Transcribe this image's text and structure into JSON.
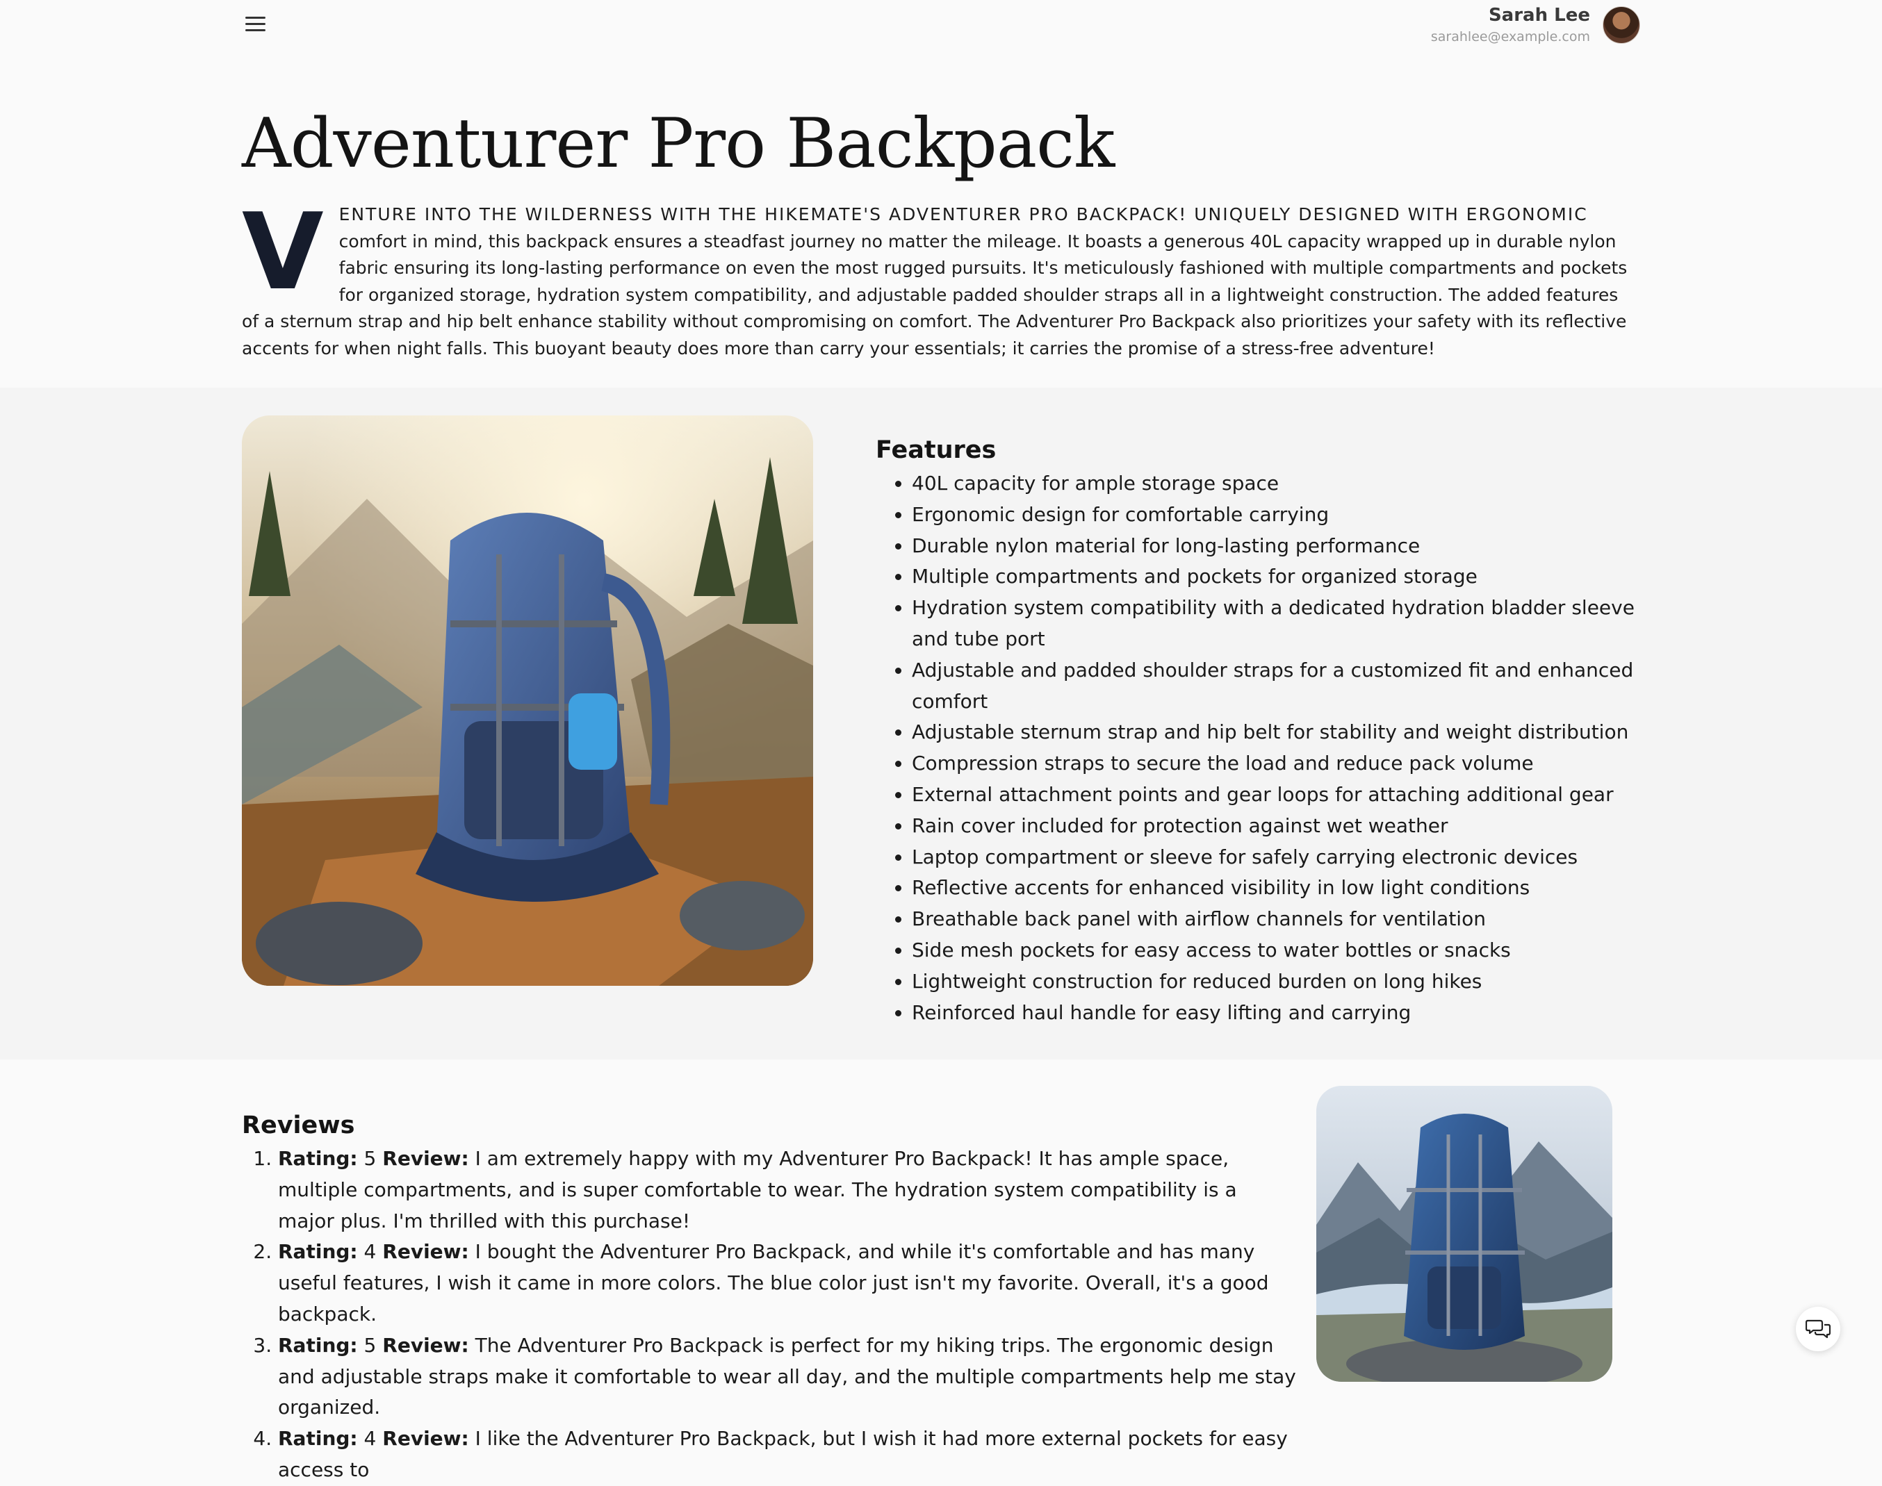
{
  "header": {
    "menu_icon": "hamburger-menu-icon",
    "user": {
      "name": "Sarah Lee",
      "email": "sarahlee@example.com"
    }
  },
  "product": {
    "title": "Adventurer Pro Backpack",
    "intro_dropcap": "V",
    "intro_lead": "enture into the wilderness with the HikeMate's Adventurer Pro Backpack! Uniquely designed with ergonomic",
    "intro_rest": "comfort in mind, this backpack ensures a steadfast journey no matter the mileage. It boasts a generous 40L capacity wrapped up in durable nylon fabric ensuring its long-lasting performance on even the most rugged pursuits. It's meticulously fashioned with multiple compartments and pockets for organized storage, hydration system compatibility, and adjustable padded shoulder straps all in a lightweight construction. The added features of a sternum strap and hip belt enhance stability without compromising on comfort. The Adventurer Pro Backpack also prioritizes your safety with its reflective accents for when night falls. This buoyant beauty does more than carry your essentials; it carries the promise of a stress-free adventure!"
  },
  "features": {
    "heading": "Features",
    "items": [
      "40L capacity for ample storage space",
      "Ergonomic design for comfortable carrying",
      "Durable nylon material for long-lasting performance",
      "Multiple compartments and pockets for organized storage",
      "Hydration system compatibility with a dedicated hydration bladder sleeve and tube port",
      "Adjustable and padded shoulder straps for a customized fit and enhanced comfort",
      "Adjustable sternum strap and hip belt for stability and weight distribution",
      "Compression straps to secure the load and reduce pack volume",
      "External attachment points and gear loops for attaching additional gear",
      "Rain cover included for protection against wet weather",
      "Laptop compartment or sleeve for safely carrying electronic devices",
      "Reflective accents for enhanced visibility in low light conditions",
      "Breathable back panel with airflow channels for ventilation",
      "Side mesh pockets for easy access to water bottles or snacks",
      "Lightweight construction for reduced burden on long hikes",
      "Reinforced haul handle for easy lifting and carrying"
    ]
  },
  "reviews": {
    "heading": "Reviews",
    "rating_label": "Rating:",
    "review_label": "Review:",
    "items": [
      {
        "rating": "5",
        "text": "I am extremely happy with my Adventurer Pro Backpack! It has ample space, multiple compartments, and is super comfortable to wear. The hydration system compatibility is a major plus. I'm thrilled with this purchase!"
      },
      {
        "rating": "4",
        "text": "I bought the Adventurer Pro Backpack, and while it's comfortable and has many useful features, I wish it came in more colors. The blue color just isn't my favorite. Overall, it's a good backpack."
      },
      {
        "rating": "5",
        "text": "The Adventurer Pro Backpack is perfect for my hiking trips. The ergonomic design and adjustable straps make it comfortable to wear all day, and the multiple compartments help me stay organized."
      },
      {
        "rating": "4",
        "text": "I like the Adventurer Pro Backpack, but I wish it had more external pockets for easy access to"
      }
    ]
  },
  "chat": {
    "icon": "chat-bubbles-icon"
  }
}
